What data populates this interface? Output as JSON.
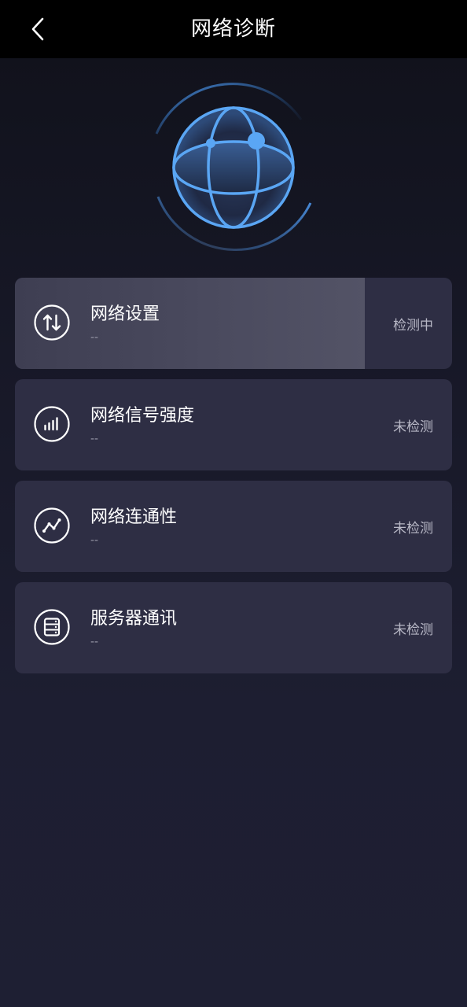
{
  "header": {
    "title": "网络诊断",
    "back_icon": "chevron-left-icon"
  },
  "hero": {
    "icon": "globe-icon",
    "accent": "#4a90e2"
  },
  "items": [
    {
      "name": "network-settings",
      "icon": "updown-arrows-icon",
      "title": "网络设置",
      "sub": "--",
      "status": "检测中",
      "progress": 0.8
    },
    {
      "name": "signal-strength",
      "icon": "signal-bars-icon",
      "title": "网络信号强度",
      "sub": "--",
      "status": "未检测",
      "progress": 0
    },
    {
      "name": "connectivity",
      "icon": "line-graph-icon",
      "title": "网络连通性",
      "sub": "--",
      "status": "未检测",
      "progress": 0
    },
    {
      "name": "server-communication",
      "icon": "server-icon",
      "title": "服务器通讯",
      "sub": "--",
      "status": "未检测",
      "progress": 0
    }
  ]
}
